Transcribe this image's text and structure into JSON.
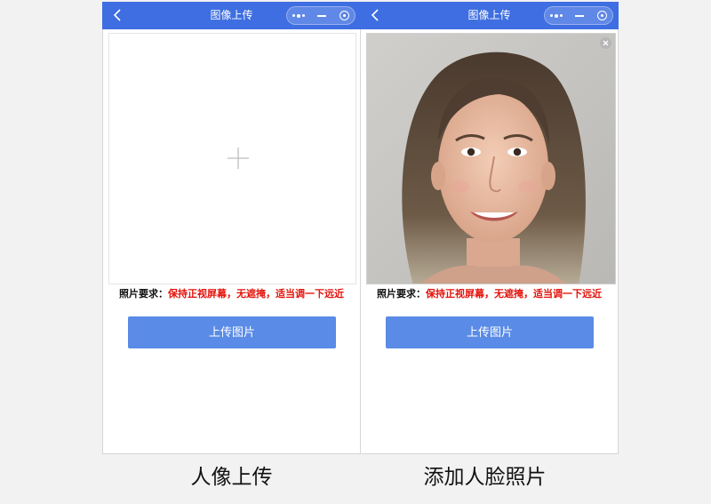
{
  "screens": [
    {
      "title": "图像上传",
      "requirement_label": "照片要求：",
      "requirement_text": "保持正视屏幕，无遮掩，适当调一下远近",
      "upload_button": "上传图片",
      "state": "empty"
    },
    {
      "title": "图像上传",
      "requirement_label": "照片要求：",
      "requirement_text": "保持正视屏幕，无遮掩，适当调一下远近",
      "upload_button": "上传图片",
      "state": "photo-added"
    }
  ],
  "captions": [
    "人像上传",
    "添加人脸照片"
  ],
  "icons": {
    "back": "chevron-left-icon",
    "more": "more-dots-icon",
    "minimize": "minimize-icon",
    "close": "target-close-icon",
    "add": "plus-icon",
    "remove": "close-x-icon"
  },
  "colors": {
    "titlebar": "#3e6ee1",
    "button": "#5a8be6",
    "requirement": "#e3120b",
    "background": "#f2f2f2"
  }
}
